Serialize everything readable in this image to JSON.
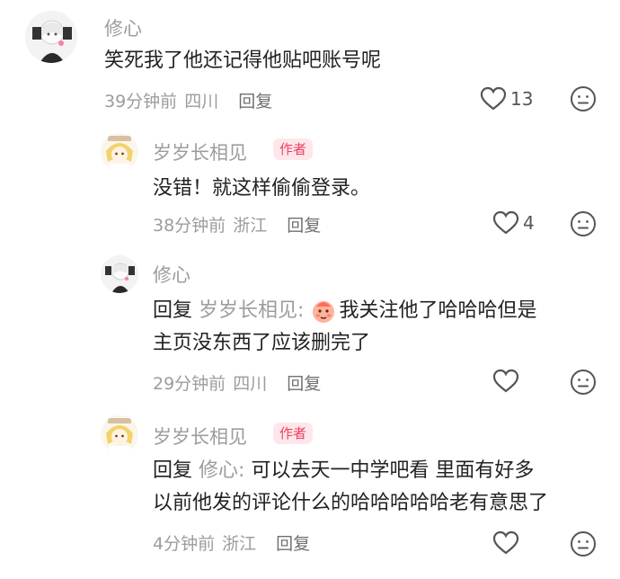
{
  "comments": [
    {
      "author": "修心",
      "text": "笑死我了他还记得他贴吧账号呢",
      "time": "39分钟前",
      "location": "四川",
      "reply_label": "回复",
      "likes": "13"
    },
    {
      "author": "岁岁长相见",
      "badge": "作者",
      "text": "没错！就这样偷偷登录。",
      "time": "38分钟前",
      "location": "浙江",
      "reply_label": "回复",
      "likes": "4"
    },
    {
      "author": "修心",
      "reply_prefix": "回复",
      "reply_to": "岁岁长相见:",
      "line1": "我关注他了哈哈哈但是",
      "line2": "主页没东西了应该删完了",
      "time": "29分钟前",
      "location": "四川",
      "reply_label": "回复"
    },
    {
      "author": "岁岁长相见",
      "badge": "作者",
      "reply_prefix": "回复",
      "reply_to": "修心:",
      "line1": "可以去天一中学吧看 里面有好多",
      "line2": "以前他发的评论什么的哈哈哈哈哈老有意思了",
      "time": "4分钟前",
      "location": "浙江",
      "reply_label": "回复"
    }
  ],
  "icons": {
    "like": "heart-outline-icon",
    "dislike": "neutral-face-icon"
  }
}
